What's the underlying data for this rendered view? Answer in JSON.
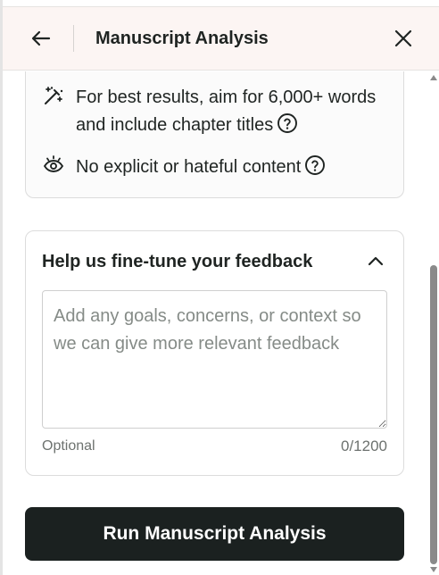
{
  "header": {
    "title": "Manuscript Analysis",
    "back_icon": "arrow-left-icon",
    "close_icon": "close-icon",
    "background": "#fcf5f3"
  },
  "tips": {
    "items": [
      {
        "icon": "magic-wand-icon",
        "text": "For best results, aim for 6,000+ words and include chapter titles",
        "has_help": true
      },
      {
        "icon": "eye-icon",
        "text": "No explicit or hateful content",
        "has_help": true
      }
    ]
  },
  "feedback": {
    "title": "Help us fine-tune your feedback",
    "expanded": true,
    "input_value": "",
    "input_placeholder": "Add any goals, concerns, or context so we can give more relevant feedback",
    "optional_label": "Optional",
    "char_count": "0/1200"
  },
  "actions": {
    "run_label": "Run Manuscript Analysis",
    "run_color": "#1b2120"
  },
  "colors": {
    "text": "#1f2422",
    "muted": "#6d726f",
    "border": "#dcdcdc"
  }
}
